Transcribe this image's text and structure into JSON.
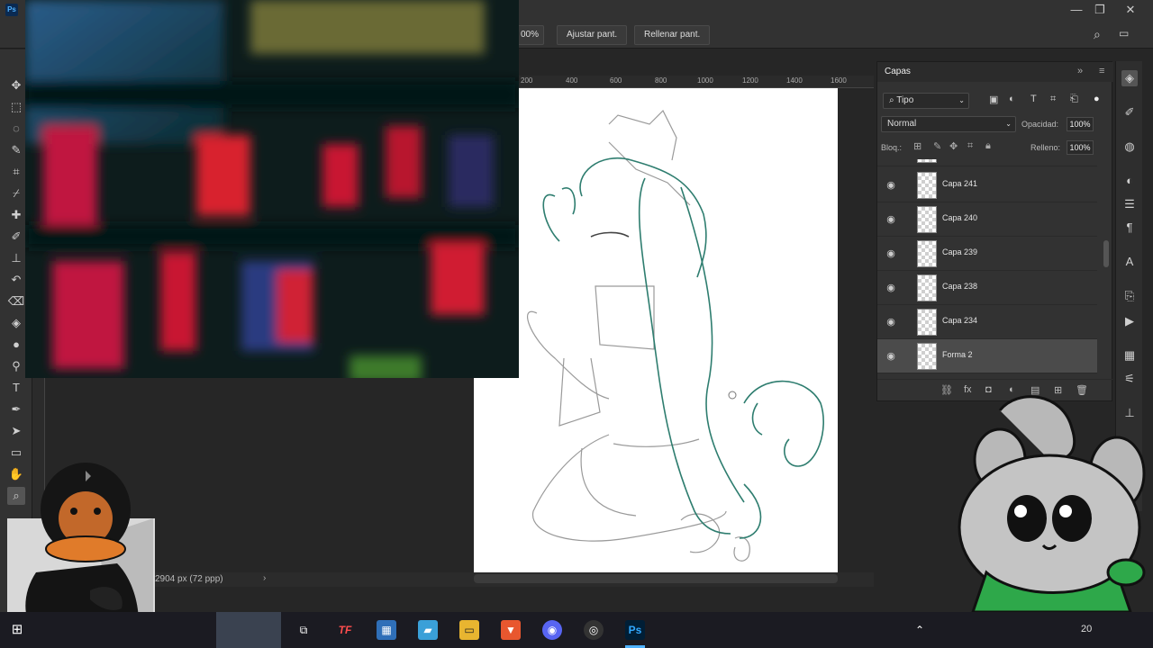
{
  "app": {
    "logo_text": "Ps",
    "window_controls": [
      "—",
      "❐",
      "✕"
    ]
  },
  "options_bar": {
    "zoom_value": "00%",
    "fit_screen": "Ajustar pant.",
    "fill_screen": "Rellenar pant."
  },
  "ruler": {
    "ticks": [
      "200",
      "400",
      "600",
      "800",
      "1000",
      "1200",
      "1400",
      "1600"
    ]
  },
  "status": {
    "doc_info": "2904 px (72 ppp)"
  },
  "layers_panel": {
    "title": "Capas",
    "filter_kind": "Tipo",
    "blend_mode": "Normal",
    "opacity_label": "Opacidad:",
    "opacity_value": "100%",
    "lock_label": "Bloq.:",
    "fill_label": "Relleno:",
    "fill_value": "100%",
    "layers": [
      {
        "name": "Capa 241"
      },
      {
        "name": "Capa 240"
      },
      {
        "name": "Capa 239"
      },
      {
        "name": "Capa 238"
      },
      {
        "name": "Capa 234"
      },
      {
        "name": "Forma 2"
      }
    ]
  },
  "taskbar": {
    "partial_label": "20"
  },
  "colors": {
    "accent_teal": "#2e7d6f",
    "sketch_gray": "#8a8a8a",
    "book_red": "#d0203a",
    "mascot_green": "#2ea84a"
  }
}
